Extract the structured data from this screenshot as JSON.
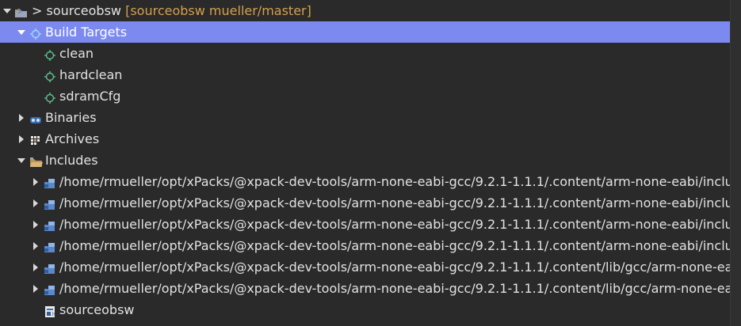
{
  "project": {
    "prefix": ">",
    "name": "sourceobsw",
    "decoration": "[sourceobsw mueller/master]"
  },
  "build_targets": {
    "label": "Build Targets",
    "items": [
      "clean",
      "hardclean",
      "sdramCfg"
    ]
  },
  "binaries": {
    "label": "Binaries"
  },
  "archives": {
    "label": "Archives"
  },
  "includes": {
    "label": "Includes",
    "paths": [
      "/home/rmueller/opt/xPacks/@xpack-dev-tools/arm-none-eabi-gcc/9.2.1-1.1.1/.content/arm-none-eabi/includ",
      "/home/rmueller/opt/xPacks/@xpack-dev-tools/arm-none-eabi-gcc/9.2.1-1.1.1/.content/arm-none-eabi/includ",
      "/home/rmueller/opt/xPacks/@xpack-dev-tools/arm-none-eabi-gcc/9.2.1-1.1.1/.content/arm-none-eabi/includ",
      "/home/rmueller/opt/xPacks/@xpack-dev-tools/arm-none-eabi-gcc/9.2.1-1.1.1/.content/arm-none-eabi/includ",
      "/home/rmueller/opt/xPacks/@xpack-dev-tools/arm-none-eabi-gcc/9.2.1-1.1.1/.content/lib/gcc/arm-none-ea",
      "/home/rmueller/opt/xPacks/@xpack-dev-tools/arm-none-eabi-gcc/9.2.1-1.1.1/.content/lib/gcc/arm-none-ea"
    ]
  },
  "source_folder": {
    "label": "sourceobsw"
  },
  "colors": {
    "background": "#2a2a2a",
    "selection": "#7c8af0",
    "decoration": "#d3a04d",
    "text": "#e2e2e2"
  },
  "icons": {
    "project": "project-folder-icon",
    "build_target": "build-target-icon",
    "binaries": "binaries-icon",
    "archives": "archives-icon",
    "includes": "includes-folder-icon",
    "include_path": "include-path-icon",
    "source_folder": "source-folder-icon"
  }
}
